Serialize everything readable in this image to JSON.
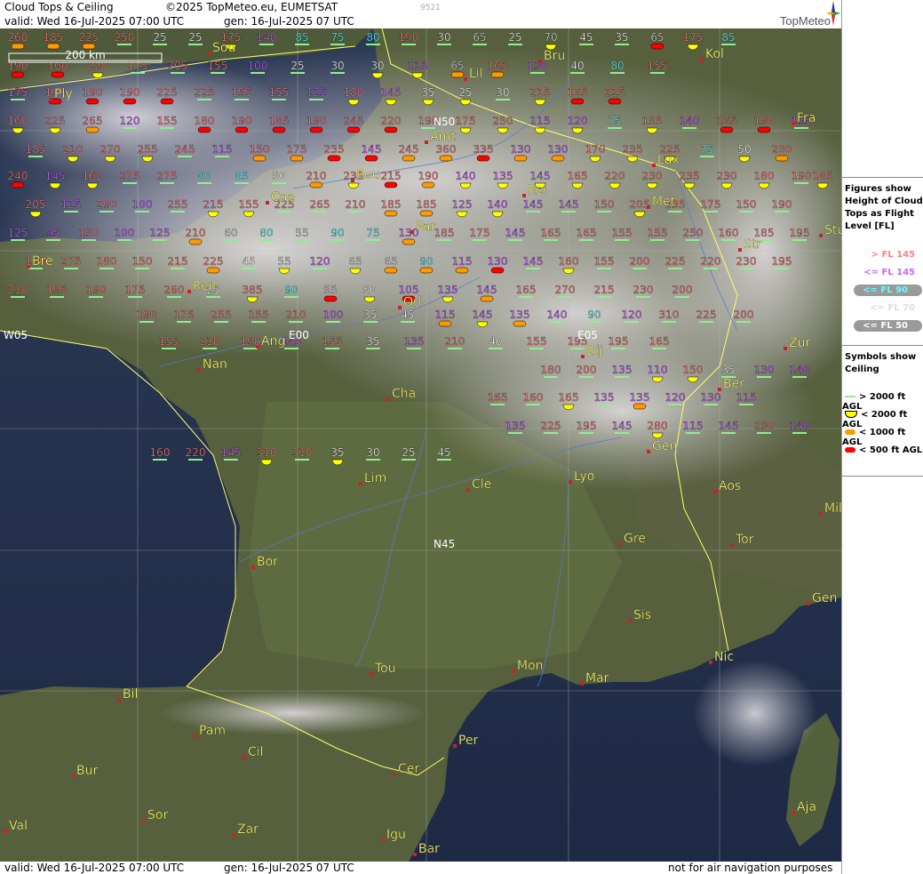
{
  "header": {
    "title": "Cloud Tops & Ceiling",
    "copyright": "©2025 TopMeteo.eu, EUMETSAT",
    "code": "9521",
    "valid": "valid:  Wed  16-Jul-2025  07:00 UTC",
    "gen": "gen: 16-Jul-2025 07 UTC",
    "logo": "TopMeteo"
  },
  "footer": {
    "valid": "valid:  Wed  16-Jul-2025  07:00 UTC",
    "gen": "gen: 16-Jul-2025 07 UTC",
    "disclaimer": "not for air navigation purposes"
  },
  "scale_label": "200 km",
  "legend_tops": {
    "title": "Figures show Height of Cloud Tops as Flight Level [FL]",
    "items": [
      {
        "label": "> FL 145",
        "color": "#ff8080",
        "bubble": false
      },
      {
        "label": "<= FL 145",
        "color": "#cc66ff",
        "bubble": false
      },
      {
        "label": "<= FL 90",
        "color": "#66ffff",
        "bubble": true
      },
      {
        "label": "<= FL 70",
        "color": "#dddddd",
        "bubble": false
      },
      {
        "label": "<= FL 50",
        "color": "#ffffff",
        "bubble": true
      }
    ]
  },
  "legend_ceiling": {
    "title": "Symbols show Ceiling",
    "items": [
      {
        "label": "> 2000 ft AGL",
        "color": "#90ee90"
      },
      {
        "label": "< 2000 ft AGL",
        "color": "#ffff00"
      },
      {
        "label": "< 1000 ft AGL",
        "color": "#ff9900"
      },
      {
        "label": "< 500 ft AGL",
        "color": "#ff0000"
      }
    ]
  },
  "grid_labels": [
    "W05",
    "E00",
    "E05",
    "N50",
    "N45"
  ],
  "cities": [
    "Sou",
    "Bru",
    "Kol",
    "Lil",
    "Ply",
    "Fra",
    "Amt",
    "Lux",
    "Rou",
    "Rei",
    "Cae",
    "Met",
    "Par",
    "Str",
    "Bre",
    "Ren",
    "Orl",
    "Ang",
    "Dij",
    "Zur",
    "Nan",
    "Ber",
    "Cha",
    "Gen",
    "Lim",
    "Cle",
    "Lyo",
    "Aos",
    "Mil",
    "Gre",
    "Tor",
    "Bor",
    "Sis",
    "Gen",
    "Tou",
    "Mon",
    "Mar",
    "Nic",
    "Bil",
    "Pam",
    "Cil",
    "Per",
    "Cer",
    "Bur",
    "Sor",
    "Zar",
    "Val",
    "Igu",
    "Bar",
    "Aja",
    "Stu"
  ],
  "observations": [
    {
      "v": "260",
      "c": "o"
    },
    {
      "v": "185",
      "c": "o"
    },
    {
      "v": "225",
      "c": "o"
    },
    {
      "v": "250",
      "c": "g"
    },
    {
      "v": "25",
      "c": "g"
    },
    {
      "v": "25",
      "c": "g"
    },
    {
      "v": "175",
      "c": "y"
    },
    {
      "v": "140",
      "c": "g"
    },
    {
      "v": "85",
      "c": "g"
    },
    {
      "v": "75",
      "c": "g"
    },
    {
      "v": "80",
      "c": "g"
    },
    {
      "v": "190",
      "c": "g"
    },
    {
      "v": "30",
      "c": "g"
    },
    {
      "v": "65",
      "c": "g"
    },
    {
      "v": "25",
      "c": "g"
    },
    {
      "v": "70",
      "c": "y"
    },
    {
      "v": "45",
      "c": "g"
    },
    {
      "v": "35",
      "c": "g"
    },
    {
      "v": "65",
      "c": "r"
    },
    {
      "v": "175",
      "c": "y"
    },
    {
      "v": "85",
      "c": "g"
    },
    {
      "v": "190",
      "c": "r"
    },
    {
      "v": "160",
      "c": "r"
    },
    {
      "v": "220",
      "c": "y"
    },
    {
      "v": "175",
      "c": "g"
    },
    {
      "v": "205",
      "c": "g"
    },
    {
      "v": "155",
      "c": "g"
    },
    {
      "v": "100",
      "c": "g"
    },
    {
      "v": "25",
      "c": "g"
    },
    {
      "v": "30",
      "c": "g"
    },
    {
      "v": "30",
      "c": "y"
    },
    {
      "v": "115",
      "c": "y"
    },
    {
      "v": "65",
      "c": "o"
    },
    {
      "v": "165",
      "c": "o"
    },
    {
      "v": "130",
      "c": "g"
    },
    {
      "v": "40",
      "c": "g"
    },
    {
      "v": "80",
      "c": "g"
    },
    {
      "v": "155",
      "c": "g"
    },
    {
      "v": "175",
      "c": "g"
    },
    {
      "v": "190",
      "c": "r"
    },
    {
      "v": "190",
      "c": "r"
    },
    {
      "v": "190",
      "c": "r"
    },
    {
      "v": "225",
      "c": "r"
    },
    {
      "v": "225",
      "c": "g"
    },
    {
      "v": "195",
      "c": "g"
    },
    {
      "v": "155",
      "c": "g"
    },
    {
      "v": "125",
      "c": "g"
    },
    {
      "v": "180",
      "c": "y"
    },
    {
      "v": "145",
      "c": "y"
    },
    {
      "v": "35",
      "c": "y"
    },
    {
      "v": "25",
      "c": "y"
    },
    {
      "v": "30",
      "c": "g"
    },
    {
      "v": "215",
      "c": "y"
    },
    {
      "v": "165",
      "c": "r"
    },
    {
      "v": "225",
      "c": "r"
    },
    {
      "v": "160",
      "c": "y"
    },
    {
      "v": "225",
      "c": "y"
    },
    {
      "v": "265",
      "c": "o"
    },
    {
      "v": "120",
      "c": "g"
    },
    {
      "v": "155",
      "c": "g"
    },
    {
      "v": "180",
      "c": "r"
    },
    {
      "v": "190",
      "c": "r"
    },
    {
      "v": "185",
      "c": "r"
    },
    {
      "v": "190",
      "c": "r"
    },
    {
      "v": "245",
      "c": "r"
    },
    {
      "v": "220",
      "c": "r"
    },
    {
      "v": "190",
      "c": "g"
    },
    {
      "v": "175",
      "c": "y"
    },
    {
      "v": "250",
      "c": "y"
    },
    {
      "v": "115",
      "c": "y"
    },
    {
      "v": "120",
      "c": "y"
    },
    {
      "v": "75",
      "c": "g"
    },
    {
      "v": "155",
      "c": "y"
    },
    {
      "v": "140",
      "c": "g"
    },
    {
      "v": "165",
      "c": "r"
    },
    {
      "v": "190",
      "c": "r"
    },
    {
      "v": "135",
      "c": "g"
    },
    {
      "v": "185",
      "c": "g"
    },
    {
      "v": "210",
      "c": "y"
    },
    {
      "v": "270",
      "c": "y"
    },
    {
      "v": "255",
      "c": "y"
    },
    {
      "v": "245",
      "c": "g"
    },
    {
      "v": "115",
      "c": "g"
    },
    {
      "v": "150",
      "c": "o"
    },
    {
      "v": "175",
      "c": "o"
    },
    {
      "v": "235",
      "c": "r"
    },
    {
      "v": "145",
      "c": "r"
    },
    {
      "v": "245",
      "c": "o"
    },
    {
      "v": "360",
      "c": "o"
    },
    {
      "v": "335",
      "c": "r"
    },
    {
      "v": "130",
      "c": "o"
    },
    {
      "v": "130",
      "c": "o"
    },
    {
      "v": "170",
      "c": "y"
    },
    {
      "v": "235",
      "c": "y"
    },
    {
      "v": "225",
      "c": "y"
    },
    {
      "v": "75",
      "c": "g"
    },
    {
      "v": "50",
      "c": "y"
    },
    {
      "v": "200",
      "c": "o"
    },
    {
      "v": "240",
      "c": "r"
    },
    {
      "v": "145",
      "c": "y"
    },
    {
      "v": "160",
      "c": "y"
    },
    {
      "v": "275",
      "c": "g"
    },
    {
      "v": "275",
      "c": "g"
    },
    {
      "v": "80",
      "c": "g"
    },
    {
      "v": "85",
      "c": "g"
    },
    {
      "v": "50",
      "c": "g"
    },
    {
      "v": "210",
      "c": "o"
    },
    {
      "v": "235",
      "c": "y"
    },
    {
      "v": "215",
      "c": "r"
    },
    {
      "v": "190",
      "c": "o"
    },
    {
      "v": "140",
      "c": "y"
    },
    {
      "v": "135",
      "c": "y"
    },
    {
      "v": "145",
      "c": "y"
    },
    {
      "v": "165",
      "c": "y"
    },
    {
      "v": "220",
      "c": "y"
    },
    {
      "v": "230",
      "c": "y"
    },
    {
      "v": "235",
      "c": "y"
    },
    {
      "v": "230",
      "c": "y"
    },
    {
      "v": "180",
      "c": "y"
    },
    {
      "v": "190",
      "c": "g"
    },
    {
      "v": "185",
      "c": "y"
    },
    {
      "v": "205",
      "c": "y"
    },
    {
      "v": "125",
      "c": "g"
    },
    {
      "v": "290",
      "c": "g"
    },
    {
      "v": "100",
      "c": "g"
    },
    {
      "v": "255",
      "c": "g"
    },
    {
      "v": "215",
      "c": "y"
    },
    {
      "v": "155",
      "c": "y"
    },
    {
      "v": "225",
      "c": "g"
    },
    {
      "v": "265",
      "c": "g"
    },
    {
      "v": "210",
      "c": "g"
    },
    {
      "v": "185",
      "c": "o"
    },
    {
      "v": "185",
      "c": "o"
    },
    {
      "v": "125",
      "c": "y"
    },
    {
      "v": "140",
      "c": "y"
    },
    {
      "v": "145",
      "c": "g"
    },
    {
      "v": "145",
      "c": "g"
    },
    {
      "v": "150",
      "c": "g"
    },
    {
      "v": "205",
      "c": "y"
    },
    {
      "v": "235",
      "c": "g"
    },
    {
      "v": "175",
      "c": "g"
    },
    {
      "v": "150",
      "c": "g"
    },
    {
      "v": "190",
      "c": "g"
    },
    {
      "v": "125",
      "c": "g"
    },
    {
      "v": "95",
      "c": "g"
    },
    {
      "v": "150",
      "c": "g"
    },
    {
      "v": "100",
      "c": "g"
    },
    {
      "v": "125",
      "c": "g"
    },
    {
      "v": "210",
      "c": "o"
    },
    {
      "v": "60",
      "c": "g"
    },
    {
      "v": "80",
      "c": "g"
    },
    {
      "v": "55",
      "c": "g"
    },
    {
      "v": "90",
      "c": "g"
    },
    {
      "v": "75",
      "c": "g"
    },
    {
      "v": "130",
      "c": "o"
    },
    {
      "v": "185",
      "c": "g"
    },
    {
      "v": "175",
      "c": "g"
    },
    {
      "v": "145",
      "c": "g"
    },
    {
      "v": "165",
      "c": "g"
    },
    {
      "v": "165",
      "c": "g"
    },
    {
      "v": "155",
      "c": "g"
    },
    {
      "v": "155",
      "c": "g"
    },
    {
      "v": "250",
      "c": "g"
    },
    {
      "v": "160",
      "c": "g"
    },
    {
      "v": "185",
      "c": "g"
    },
    {
      "v": "195",
      "c": "g"
    },
    {
      "v": "150",
      "c": "g"
    },
    {
      "v": "275",
      "c": "g"
    },
    {
      "v": "180",
      "c": "g"
    },
    {
      "v": "150",
      "c": "g"
    },
    {
      "v": "215",
      "c": "g"
    },
    {
      "v": "225",
      "c": "o"
    },
    {
      "v": "45",
      "c": "g"
    },
    {
      "v": "55",
      "c": "y"
    },
    {
      "v": "120",
      "c": "g"
    },
    {
      "v": "65",
      "c": "y"
    },
    {
      "v": "65",
      "c": "o"
    },
    {
      "v": "90",
      "c": "o"
    },
    {
      "v": "115",
      "c": "o"
    },
    {
      "v": "130",
      "c": "r"
    },
    {
      "v": "145",
      "c": "g"
    },
    {
      "v": "160",
      "c": "y"
    },
    {
      "v": "155",
      "c": "g"
    },
    {
      "v": "200",
      "c": "g"
    },
    {
      "v": "225",
      "c": "g"
    },
    {
      "v": "220",
      "c": "g"
    },
    {
      "v": "230",
      "c": "g"
    },
    {
      "v": "195",
      "c": "g"
    },
    {
      "v": "210",
      "c": "g"
    },
    {
      "v": "195",
      "c": "g"
    },
    {
      "v": "190",
      "c": "g"
    },
    {
      "v": "175",
      "c": "g"
    },
    {
      "v": "260",
      "c": "g"
    },
    {
      "v": "25",
      "c": "g"
    },
    {
      "v": "385",
      "c": "y"
    },
    {
      "v": "90",
      "c": "g"
    },
    {
      "v": "55",
      "c": "r"
    },
    {
      "v": "50",
      "c": "y"
    },
    {
      "v": "105",
      "c": "r"
    },
    {
      "v": "135",
      "c": "y"
    },
    {
      "v": "145",
      "c": "o"
    },
    {
      "v": "165",
      "c": "g"
    },
    {
      "v": "270",
      "c": "g"
    },
    {
      "v": "215",
      "c": "g"
    },
    {
      "v": "230",
      "c": "g"
    },
    {
      "v": "200",
      "c": "g"
    },
    {
      "v": "190",
      "c": "g"
    },
    {
      "v": "175",
      "c": "g"
    },
    {
      "v": "255",
      "c": "g"
    },
    {
      "v": "155",
      "c": "g"
    },
    {
      "v": "210",
      "c": "g"
    },
    {
      "v": "100",
      "c": "g"
    },
    {
      "v": "35",
      "c": "g"
    },
    {
      "v": "45",
      "c": "g"
    },
    {
      "v": "115",
      "c": "o"
    },
    {
      "v": "145",
      "c": "y"
    },
    {
      "v": "135",
      "c": "o"
    },
    {
      "v": "140",
      "c": "g"
    },
    {
      "v": "90",
      "c": "g"
    },
    {
      "v": "120",
      "c": "g"
    },
    {
      "v": "310",
      "c": "g"
    },
    {
      "v": "225",
      "c": "g"
    },
    {
      "v": "200",
      "c": "g"
    },
    {
      "v": "155",
      "c": "g"
    },
    {
      "v": "210",
      "c": "g"
    },
    {
      "v": "190",
      "c": "g"
    },
    {
      "v": "145",
      "c": "g"
    },
    {
      "v": "155",
      "c": "g"
    },
    {
      "v": "35",
      "c": "g"
    },
    {
      "v": "135",
      "c": "g"
    },
    {
      "v": "210",
      "c": "g"
    },
    {
      "v": "40",
      "c": "g"
    },
    {
      "v": "155",
      "c": "g"
    },
    {
      "v": "195",
      "c": "g"
    },
    {
      "v": "195",
      "c": "g"
    },
    {
      "v": "165",
      "c": "g"
    },
    {
      "v": "180",
      "c": "g"
    },
    {
      "v": "200",
      "c": "g"
    },
    {
      "v": "135",
      "c": "g"
    },
    {
      "v": "110",
      "c": "y"
    },
    {
      "v": "150",
      "c": "y"
    },
    {
      "v": "35",
      "c": "g"
    },
    {
      "v": "130",
      "c": "g"
    },
    {
      "v": "140",
      "c": "g"
    },
    {
      "v": "165",
      "c": "g"
    },
    {
      "v": "160",
      "c": "g"
    },
    {
      "v": "165",
      "c": "y"
    },
    {
      "v": "135",
      "c": "g"
    },
    {
      "v": "135",
      "c": "o"
    },
    {
      "v": "120",
      "c": "g"
    },
    {
      "v": "130",
      "c": "g"
    },
    {
      "v": "115",
      "c": "g"
    },
    {
      "v": "135",
      "c": "g"
    },
    {
      "v": "225",
      "c": "g"
    },
    {
      "v": "195",
      "c": "g"
    },
    {
      "v": "145",
      "c": "g"
    },
    {
      "v": "280",
      "c": "y"
    },
    {
      "v": "115",
      "c": "g"
    },
    {
      "v": "145",
      "c": "g"
    },
    {
      "v": "230",
      "c": "g"
    },
    {
      "v": "140",
      "c": "g"
    },
    {
      "v": "160",
      "c": "g"
    },
    {
      "v": "220",
      "c": "g"
    },
    {
      "v": "145",
      "c": "g"
    },
    {
      "v": "310",
      "c": "y"
    },
    {
      "v": "310",
      "c": "g"
    },
    {
      "v": "35",
      "c": "y"
    },
    {
      "v": "30",
      "c": "g"
    },
    {
      "v": "25",
      "c": "g"
    },
    {
      "v": "45",
      "c": "g"
    },
    {
      "v": "25",
      "c": "y"
    },
    {
      "v": "45",
      "c": "o"
    },
    {
      "v": "45",
      "c": "g"
    },
    {
      "v": "35",
      "c": "y"
    },
    {
      "v": "30",
      "c": "o"
    }
  ]
}
